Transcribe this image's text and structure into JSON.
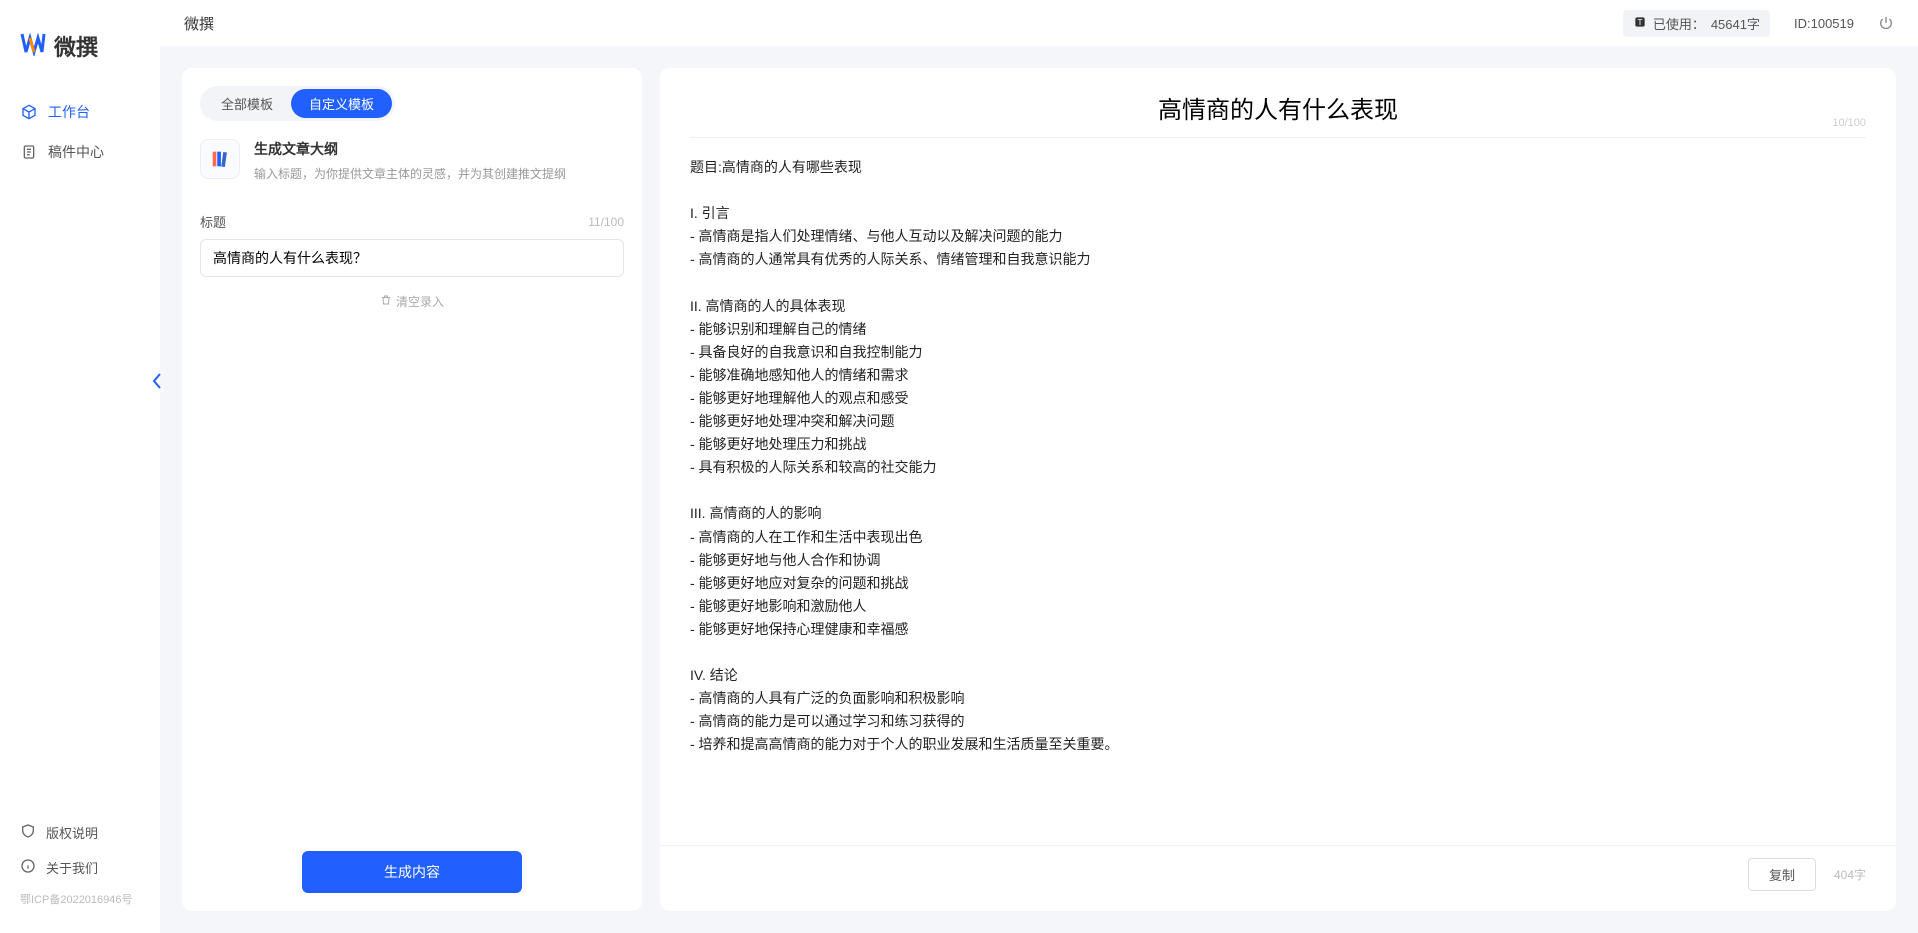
{
  "brand": {
    "name": "微撰",
    "app_title": "微撰"
  },
  "sidebar": {
    "items": [
      {
        "label": "工作台",
        "icon": "cube"
      },
      {
        "label": "稿件中心",
        "icon": "doc"
      }
    ],
    "bottom": [
      {
        "label": "版权说明",
        "icon": "shield"
      },
      {
        "label": "关于我们",
        "icon": "info"
      }
    ],
    "icp": "鄂ICP备2022016946号"
  },
  "topbar": {
    "usage_prefix": "已使用：",
    "usage_value": "45641字",
    "id_prefix": "ID:",
    "id_value": "100519"
  },
  "left": {
    "tabs": {
      "all": "全部模板",
      "custom": "自定义模板"
    },
    "template": {
      "title": "生成文章大纲",
      "desc": "输入标题，为你提供文章主体的灵感，并为其创建推文提纲"
    },
    "field_label": "标题",
    "counter": "11/100",
    "input_value": "高情商的人有什么表现？",
    "clear_label": "清空录入",
    "submit_label": "生成内容"
  },
  "right": {
    "title": "高情商的人有什么表现",
    "title_counter": "10/100",
    "body": "题目:高情商的人有哪些表现\n\nI. 引言\n- 高情商是指人们处理情绪、与他人互动以及解决问题的能力\n- 高情商的人通常具有优秀的人际关系、情绪管理和自我意识能力\n\nII. 高情商的人的具体表现\n- 能够识别和理解自己的情绪\n- 具备良好的自我意识和自我控制能力\n- 能够准确地感知他人的情绪和需求\n- 能够更好地理解他人的观点和感受\n- 能够更好地处理冲突和解决问题\n- 能够更好地处理压力和挑战\n- 具有积极的人际关系和较高的社交能力\n\nIII. 高情商的人的影响\n- 高情商的人在工作和生活中表现出色\n- 能够更好地与他人合作和协调\n- 能够更好地应对复杂的问题和挑战\n- 能够更好地影响和激励他人\n- 能够更好地保持心理健康和幸福感\n\nIV. 结论\n- 高情商的人具有广泛的负面影响和积极影响\n- 高情商的能力是可以通过学习和练习获得的\n- 培养和提高高情商的能力对于个人的职业发展和生活质量至关重要。",
    "copy_label": "复制",
    "char_count": "404字"
  }
}
